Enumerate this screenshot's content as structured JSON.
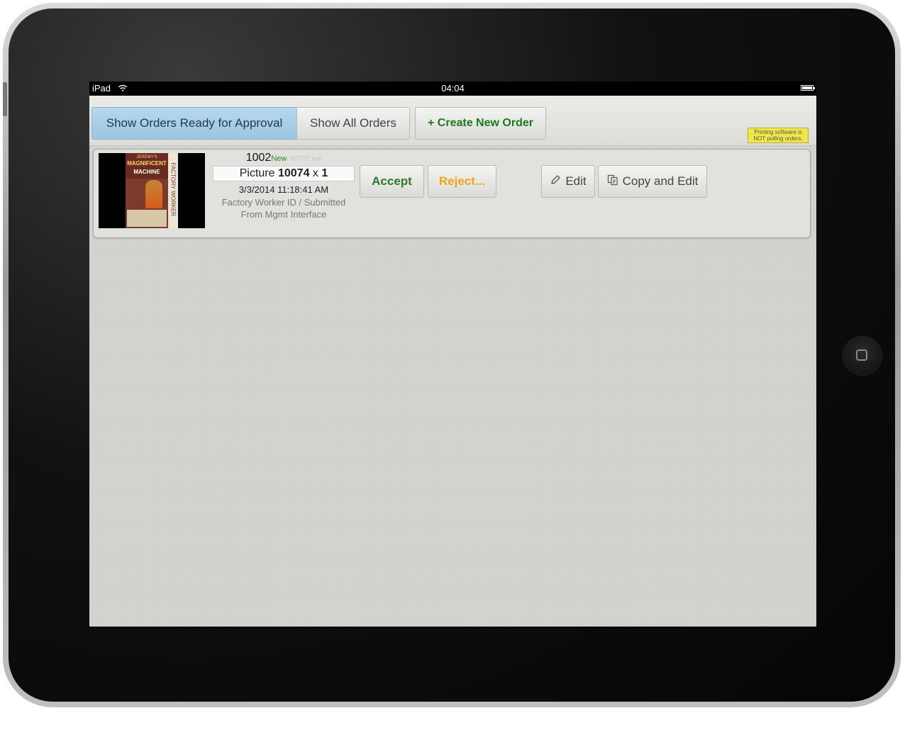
{
  "statusbar": {
    "carrier": "iPad",
    "time": "04:04"
  },
  "toolbar": {
    "approval_label": "Show Orders Ready for Approval",
    "all_label": "Show All Orders",
    "create_label": "+ Create New Order",
    "notice": "Printing software is NOT polling orders."
  },
  "order": {
    "number": "1002",
    "status": "New",
    "file": "00772.sor",
    "picture_prefix": "Picture",
    "picture_id": "10074",
    "picture_x": "x",
    "quantity": "1",
    "datetime": "3/3/2014 11:18:41 AM",
    "worker_line1": "Factory Worker ID / Submitted",
    "worker_line2": "From Mgmt Interface",
    "thumbnail": {
      "line1": "JEREMY'S",
      "line2": "MAGNIFICENT",
      "line3": "MACHINE",
      "spine": "FACTORY WORKER"
    }
  },
  "actions": {
    "accept": "Accept",
    "reject": "Reject...",
    "edit": "Edit",
    "copy_edit": "Copy and Edit"
  },
  "colors": {
    "approval_active": "#9cc6e3",
    "accept": "#2d7a2d",
    "reject": "#f5a31a",
    "create": "#1c7a1c",
    "notice_bg": "#f0e84a"
  }
}
